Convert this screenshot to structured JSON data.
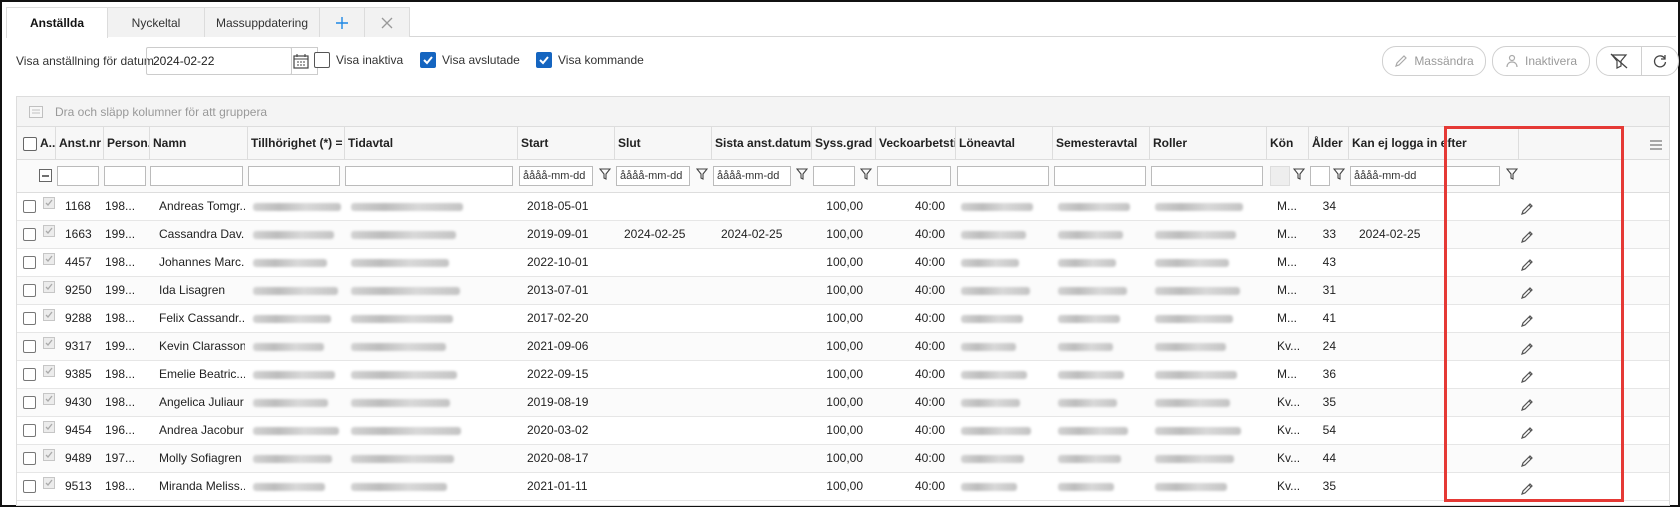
{
  "tabs": [
    {
      "label": "Anställda",
      "active": true
    },
    {
      "label": "Nyckeltal",
      "active": false
    },
    {
      "label": "Massuppdatering",
      "active": false
    }
  ],
  "toolbar": {
    "date_label": "Visa anställning för datum",
    "date_value": "2024-02-22",
    "show_inactive": {
      "label": "Visa inaktiva",
      "checked": false
    },
    "show_ended": {
      "label": "Visa avslutade",
      "checked": true
    },
    "show_upcoming": {
      "label": "Visa kommande",
      "checked": true
    },
    "mass_edit_label": "Massändra",
    "deactivate_label": "Inaktivera"
  },
  "grid": {
    "group_hint": "Dra och släpp kolumner för att gruppera",
    "group_icon": "group-columns-icon",
    "columns": [
      "A...",
      "Anst.nr",
      "Person...",
      "Namn",
      "Tillhörighet (*) = S...",
      "Tidavtal",
      "Start",
      "Slut",
      "Sista anst.datum",
      "Syss.grad",
      "Veckoarbetstid",
      "Löneavtal",
      "Semesteravtal",
      "Roller",
      "Kön",
      "Ålder",
      "Kan ej logga in efter"
    ],
    "date_placeholder": "åååå-mm-dd",
    "rows": [
      {
        "anst": "1168",
        "person": "198...",
        "name": "Andreas Tomgr...",
        "start": "2018-05-01",
        "slut": "",
        "sista": "",
        "syss": "100,00",
        "vecka": "40:00",
        "kon": "M...",
        "alder": "34",
        "kan": ""
      },
      {
        "anst": "1663",
        "person": "199...",
        "name": "Cassandra Dav...",
        "start": "2019-09-01",
        "slut": "2024-02-25",
        "sista": "2024-02-25",
        "syss": "100,00",
        "vecka": "40:00",
        "kon": "M...",
        "alder": "33",
        "kan": "2024-02-25"
      },
      {
        "anst": "4457",
        "person": "198...",
        "name": "Johannes Marc...",
        "start": "2022-10-01",
        "slut": "",
        "sista": "",
        "syss": "100,00",
        "vecka": "40:00",
        "kon": "M...",
        "alder": "43",
        "kan": ""
      },
      {
        "anst": "9250",
        "person": "199...",
        "name": "Ida Lisagren",
        "start": "2013-07-01",
        "slut": "",
        "sista": "",
        "syss": "100,00",
        "vecka": "40:00",
        "kon": "M...",
        "alder": "31",
        "kan": ""
      },
      {
        "anst": "9288",
        "person": "198...",
        "name": "Felix Cassandr...",
        "start": "2017-02-20",
        "slut": "",
        "sista": "",
        "syss": "100,00",
        "vecka": "40:00",
        "kon": "M...",
        "alder": "41",
        "kan": ""
      },
      {
        "anst": "9317",
        "person": "199...",
        "name": "Kevin Clarasson",
        "start": "2021-09-06",
        "slut": "",
        "sista": "",
        "syss": "100,00",
        "vecka": "40:00",
        "kon": "Kv...",
        "alder": "24",
        "kan": ""
      },
      {
        "anst": "9385",
        "person": "198...",
        "name": "Emelie Beatric...",
        "start": "2022-09-15",
        "slut": "",
        "sista": "",
        "syss": "100,00",
        "vecka": "40:00",
        "kon": "M...",
        "alder": "36",
        "kan": ""
      },
      {
        "anst": "9430",
        "person": "198...",
        "name": "Angelica Juliaur",
        "start": "2019-08-19",
        "slut": "",
        "sista": "",
        "syss": "100,00",
        "vecka": "40:00",
        "kon": "Kv...",
        "alder": "35",
        "kan": ""
      },
      {
        "anst": "9454",
        "person": "196...",
        "name": "Andrea Jacobur",
        "start": "2020-03-02",
        "slut": "",
        "sista": "",
        "syss": "100,00",
        "vecka": "40:00",
        "kon": "Kv...",
        "alder": "54",
        "kan": ""
      },
      {
        "anst": "9489",
        "person": "197...",
        "name": "Molly Sofiagren",
        "start": "2020-08-17",
        "slut": "",
        "sista": "",
        "syss": "100,00",
        "vecka": "40:00",
        "kon": "Kv...",
        "alder": "44",
        "kan": ""
      },
      {
        "anst": "9513",
        "person": "198...",
        "name": "Miranda Meliss...",
        "start": "2021-01-11",
        "slut": "",
        "sista": "",
        "syss": "100,00",
        "vecka": "40:00",
        "kon": "Kv...",
        "alder": "35",
        "kan": ""
      }
    ]
  },
  "colors": {
    "accent": "#1565c0",
    "highlight": "#e53935"
  }
}
